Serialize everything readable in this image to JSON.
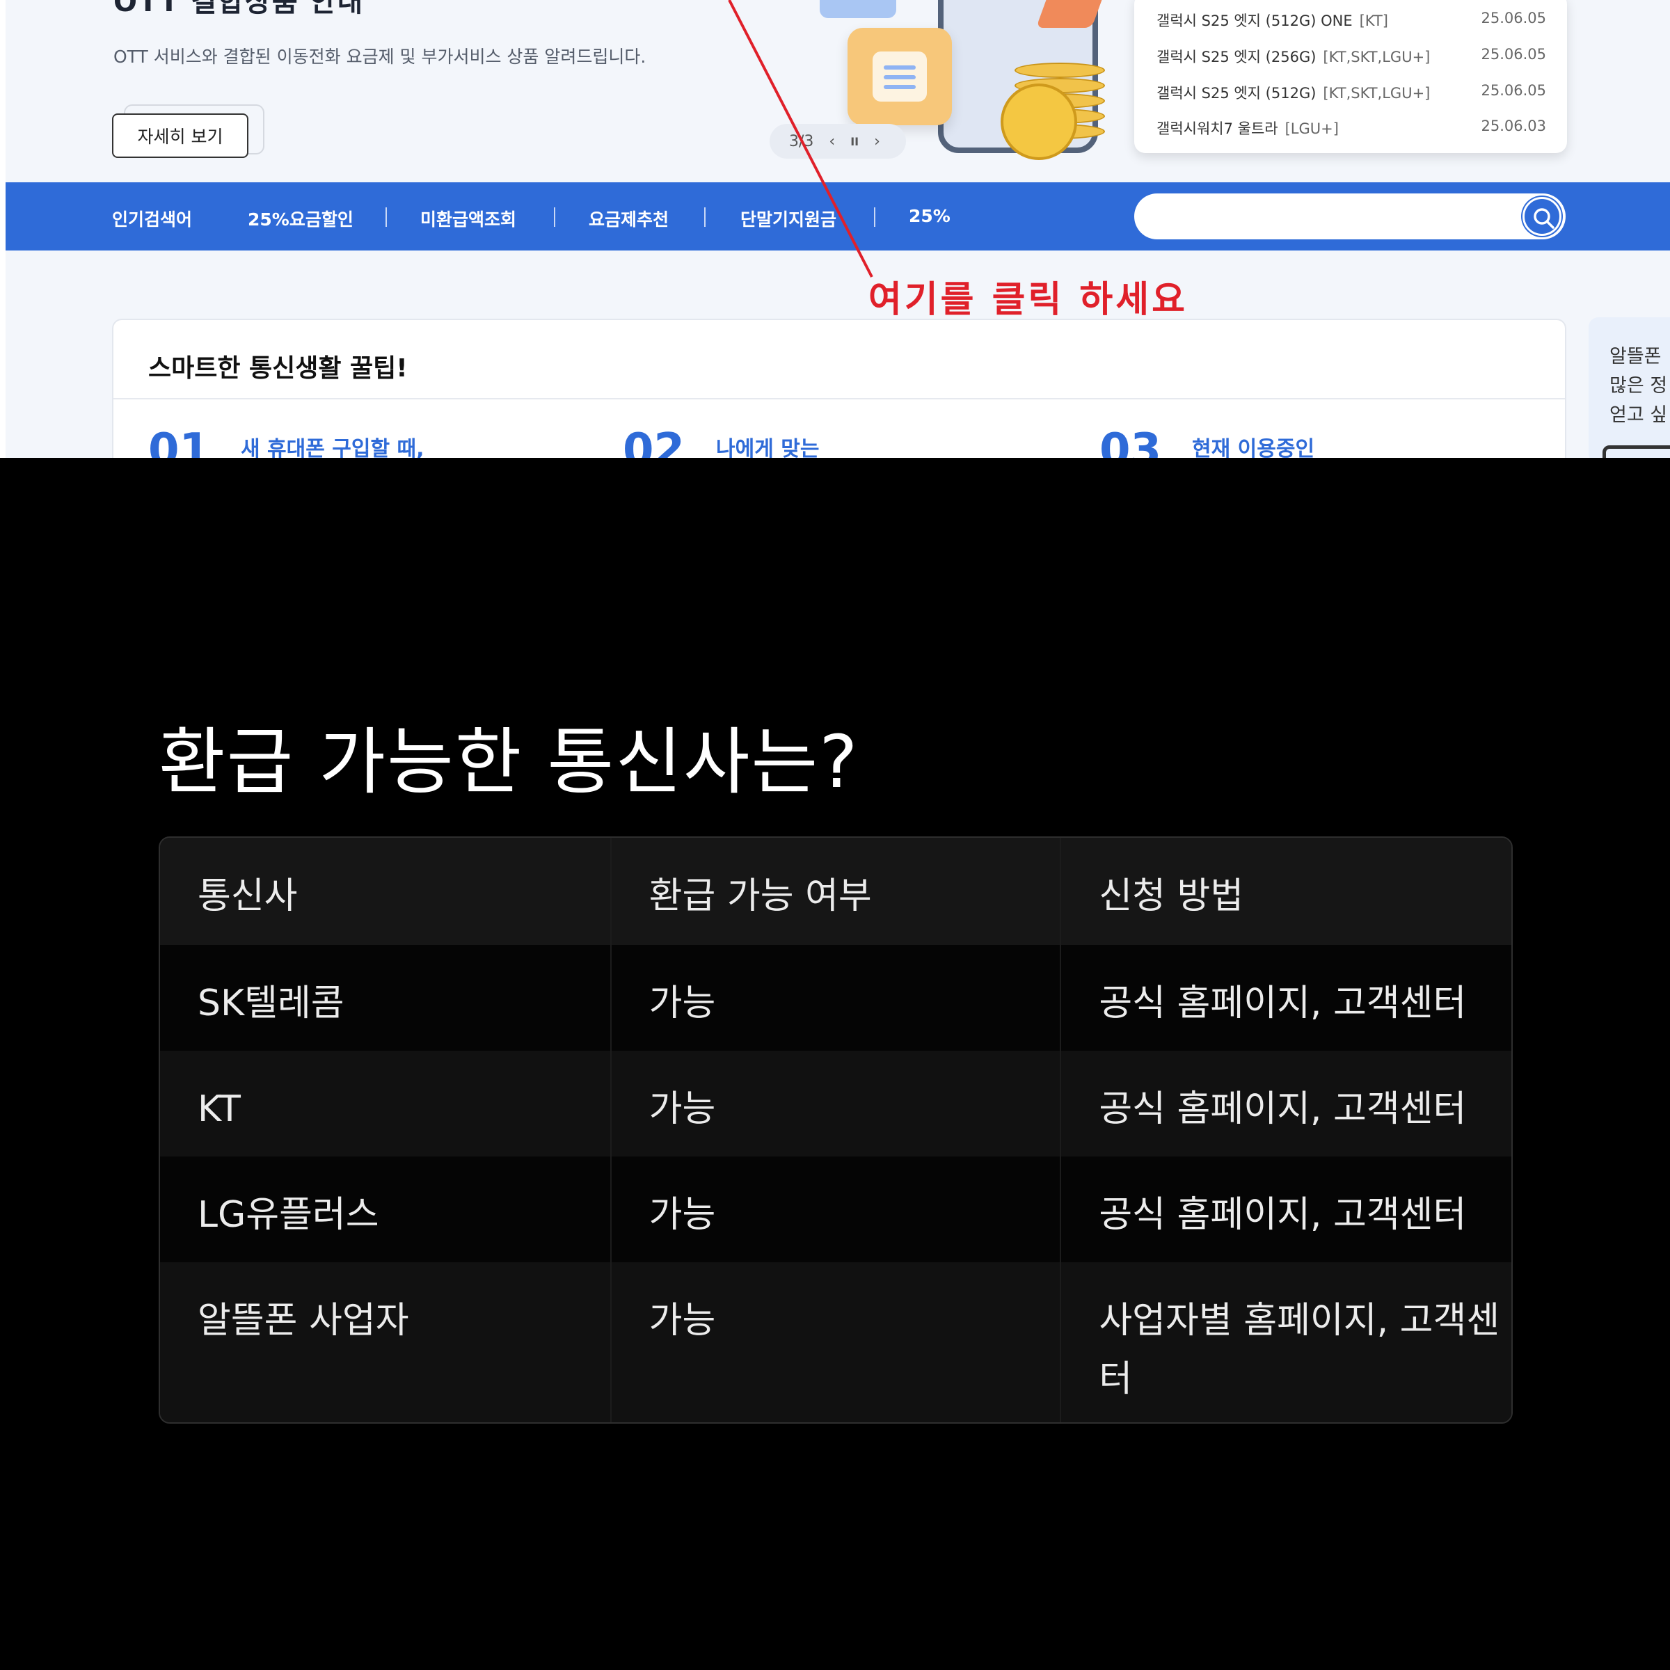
{
  "top": {
    "hero": {
      "title_cut": "OTT 결합상품 안내",
      "description": "OTT 서비스와 결합된 이동전화 요금제 및 부가서비스 상품 알려드립니다.",
      "detail_button": "자세히 보기"
    },
    "pager": {
      "current": "3/3",
      "prev": "‹",
      "pause": "II",
      "next": "›"
    },
    "news": [
      {
        "title": "갤럭시 S25 엣지 (512G) ONE",
        "tag": "[KT]",
        "date": "25.06.05"
      },
      {
        "title": "갤럭시 S25 엣지 (256G)",
        "tag": "[KT,SKT,LGU+]",
        "date": "25.06.05"
      },
      {
        "title": "갤럭시 S25 엣지 (512G)",
        "tag": "[KT,SKT,LGU+]",
        "date": "25.06.05"
      },
      {
        "title": "갤럭시워치7 울트라",
        "tag": "[LGU+]",
        "date": "25.06.03"
      }
    ],
    "nav": {
      "label": "인기검색어",
      "items": [
        "25%요금할인",
        "미환급액조회",
        "요금제추천",
        "단말기지원금",
        "25%"
      ],
      "search_placeholder": ""
    },
    "annotation": "여기를 클릭 하세요",
    "tips": {
      "title": "스마트한 통신생활 꿀팁!",
      "items": [
        {
          "num": "01",
          "text": "새 휴대폰 구입할 때,"
        },
        {
          "num": "02",
          "text": "나에게 맞는"
        },
        {
          "num": "03",
          "text": "현재 이용중인"
        }
      ]
    },
    "side": {
      "lines": [
        "알뜰폰",
        "많은 정",
        "얻고 싶"
      ]
    },
    "colors": {
      "brand_blue": "#2f6bd8",
      "annotation_red": "#e0202a"
    }
  },
  "panel": {
    "heading": "환급 가능한 통신사는?",
    "columns": [
      "통신사",
      "환급 가능 여부",
      "신청 방법"
    ],
    "rows": [
      [
        "SK텔레콤",
        "가능",
        "공식 홈페이지, 고객센터"
      ],
      [
        "KT",
        "가능",
        "공식 홈페이지, 고객센터"
      ],
      [
        "LG유플러스",
        "가능",
        "공식 홈페이지, 고객센터"
      ],
      [
        "알뜰폰 사업자",
        "가능",
        "사업자별 홈페이지, 고객센터"
      ]
    ]
  }
}
